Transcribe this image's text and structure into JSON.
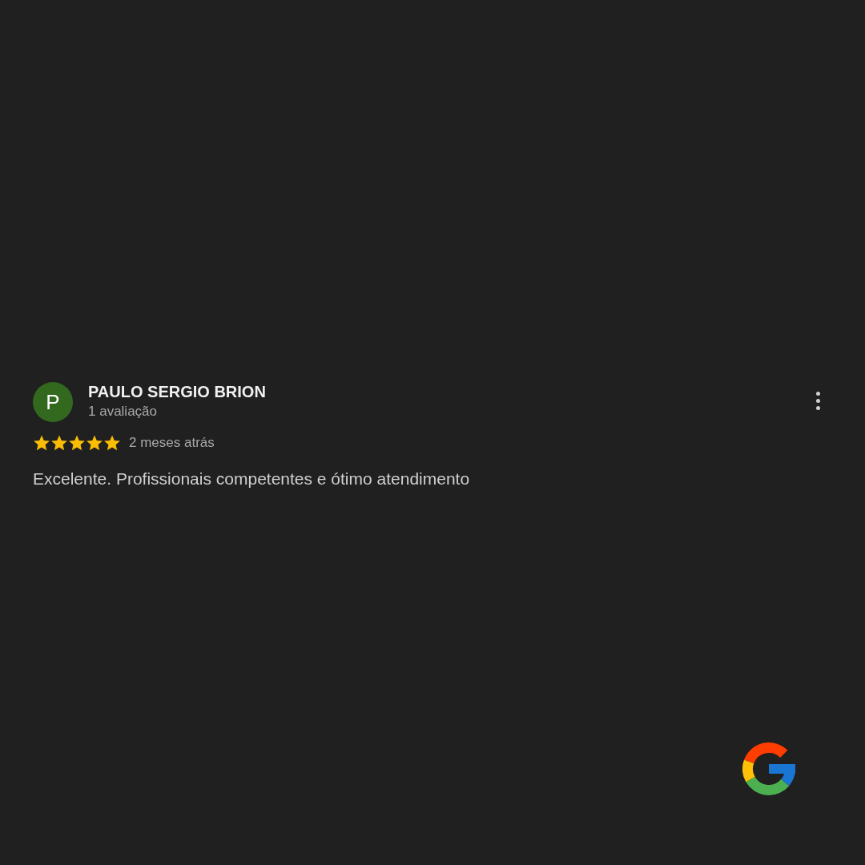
{
  "review": {
    "avatar_letter": "P",
    "author": "PAULO SERGIO BRION",
    "review_count": "1 avaliação",
    "stars": 5,
    "time": "2 meses atrás",
    "text": "Excelente. Profissionais competentes e ótimo atendimento"
  }
}
